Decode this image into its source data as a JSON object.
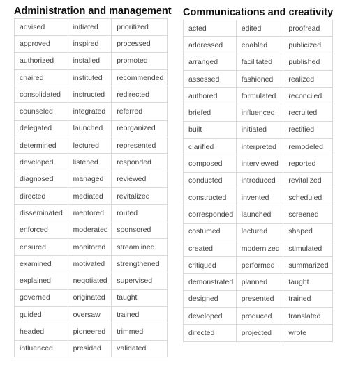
{
  "sections": [
    {
      "title": "Administration and management",
      "rows": [
        [
          "advised",
          "initiated",
          "prioritized"
        ],
        [
          "approved",
          "inspired",
          "processed"
        ],
        [
          "authorized",
          "installed",
          "promoted"
        ],
        [
          "chaired",
          "instituted",
          "recommended"
        ],
        [
          "consolidated",
          "instructed",
          "redirected"
        ],
        [
          "counseled",
          "integrated",
          "referred"
        ],
        [
          "delegated",
          "launched",
          "reorganized"
        ],
        [
          "determined",
          "lectured",
          "represented"
        ],
        [
          "developed",
          "listened",
          "responded"
        ],
        [
          "diagnosed",
          "managed",
          "reviewed"
        ],
        [
          "directed",
          "mediated",
          "revitalized"
        ],
        [
          "disseminated",
          "mentored",
          "routed"
        ],
        [
          "enforced",
          "moderated",
          "sponsored"
        ],
        [
          "ensured",
          "monitored",
          "streamlined"
        ],
        [
          "examined",
          "motivated",
          "strengthened"
        ],
        [
          "explained",
          "negotiated",
          "supervised"
        ],
        [
          "governed",
          "originated",
          "taught"
        ],
        [
          "guided",
          "oversaw",
          "trained"
        ],
        [
          "headed",
          "pioneered",
          "trimmed"
        ],
        [
          "influenced",
          "presided",
          "validated"
        ]
      ]
    },
    {
      "title": "Communications and creativity",
      "rows": [
        [
          "acted",
          "edited",
          "proofread"
        ],
        [
          "addressed",
          "enabled",
          "publicized"
        ],
        [
          "arranged",
          "facilitated",
          "published"
        ],
        [
          "assessed",
          "fashioned",
          "realized"
        ],
        [
          "authored",
          "formulated",
          "reconciled"
        ],
        [
          "briefed",
          "influenced",
          "recruited"
        ],
        [
          "built",
          "initiated",
          "rectified"
        ],
        [
          "clarified",
          "interpreted",
          "remodeled"
        ],
        [
          "composed",
          "interviewed",
          "reported"
        ],
        [
          "conducted",
          "introduced",
          "revitalized"
        ],
        [
          "constructed",
          "invented",
          "scheduled"
        ],
        [
          "corresponded",
          "launched",
          "screened"
        ],
        [
          "costumed",
          "lectured",
          "shaped"
        ],
        [
          "created",
          "modernized",
          "stimulated"
        ],
        [
          "critiqued",
          "performed",
          "summarized"
        ],
        [
          "demonstrated",
          "planned",
          "taught"
        ],
        [
          "designed",
          "presented",
          "trained"
        ],
        [
          "developed",
          "produced",
          "translated"
        ],
        [
          "directed",
          "projected",
          "wrote"
        ]
      ]
    }
  ]
}
